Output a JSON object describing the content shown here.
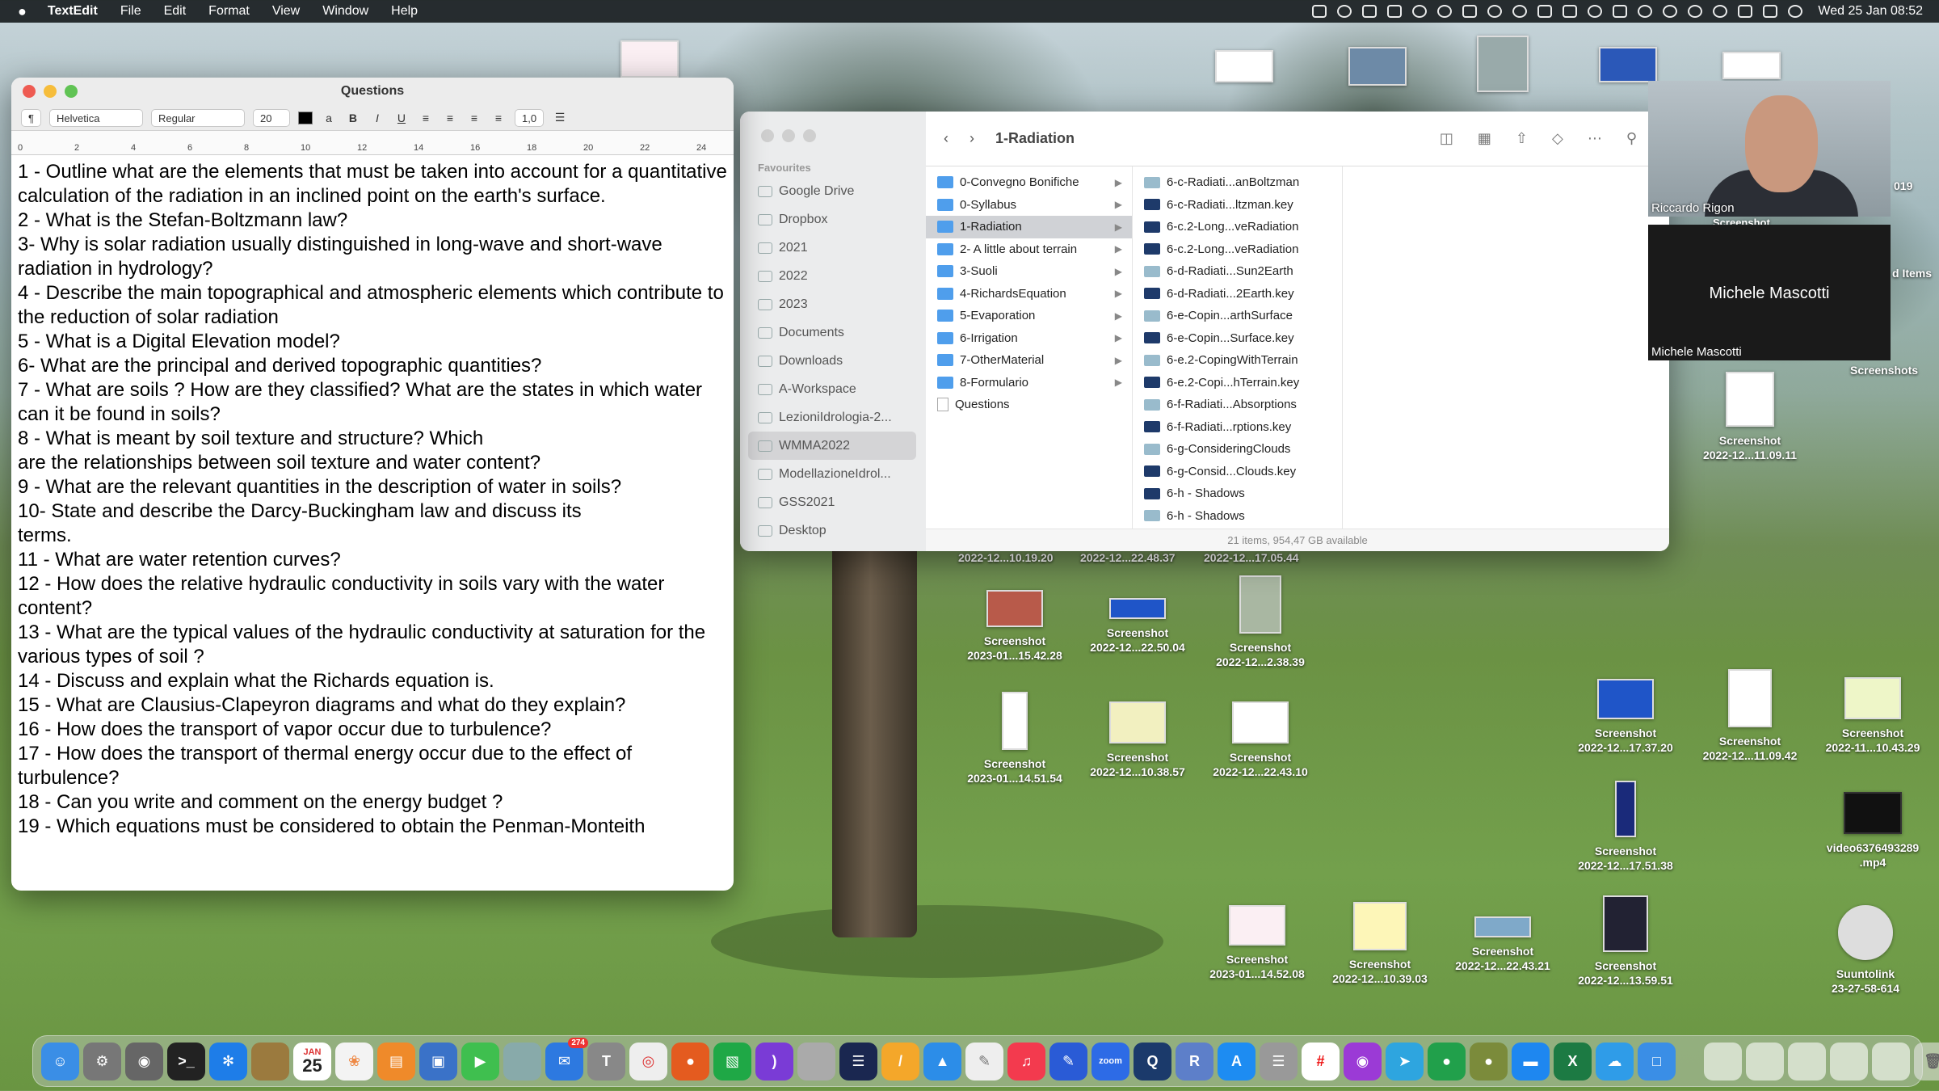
{
  "menubar": {
    "apple": "",
    "app": "TextEdit",
    "menus": [
      "File",
      "Edit",
      "Format",
      "View",
      "Window",
      "Help"
    ],
    "clock": "Wed 25 Jan  08:52"
  },
  "textedit": {
    "title": "Questions",
    "toolbar": {
      "paragraph": "¶",
      "font": "Helvetica",
      "style": "Regular",
      "size": "20",
      "spacing": "1,0"
    },
    "ruler": [
      "0",
      "2",
      "4",
      "6",
      "8",
      "10",
      "12",
      "14",
      "16",
      "18",
      "20",
      "22",
      "24"
    ],
    "lines": [
      "1 - Outline what are the elements that must be taken into account for a quantitative calculation of the radiation in an inclined point on the earth's surface.",
      "2 - What is the Stefan-Boltzmann law?",
      "3- Why is solar radiation usually distinguished in long-wave and short-wave radiation in hydrology?",
      "4 - Describe the main topographical and atmospheric elements which contribute to the reduction of solar radiation",
      "5 - What is a Digital Elevation model?",
      "6- What are the principal and derived topographic quantities?",
      "7 - What are soils ? How are they classified? What are the states in which water",
      "can it be found in soils?",
      "8 - What is meant by soil texture and structure? Which",
      "are the relationships between soil texture and water content?",
      "9 - What are the relevant quantities in the description of water in soils?",
      "10- State and describe the Darcy-Buckingham law and discuss its",
      "terms.",
      "11 - What are water retention curves?",
      "12 - How does the relative hydraulic conductivity in soils vary with the water content?",
      "13 - What are the typical values of the hydraulic conductivity at saturation for the various types of soil ?",
      "14 - Discuss and explain what the Richards equation is.",
      "15 - What are Clausius-Clapeyron diagrams and what do they explain?",
      "16 - How does the transport of vapor occur due to turbulence?",
      "17 - How does the transport of thermal energy occur due to the effect of turbulence?",
      "18 - Can you write and comment on the energy budget ?",
      "19 - Which equations must be considered to obtain the Penman-Monteith"
    ]
  },
  "finder": {
    "title": "1-Radiation",
    "sidebar_header": "Favourites",
    "sidebar": [
      "Google Drive",
      "Dropbox",
      "2021",
      "2022",
      "2023",
      "Documents",
      "Downloads",
      "A-Workspace",
      "LezioniIdrologia-2...",
      "WMMA2022",
      "ModellazioneIdrol...",
      "GSS2021",
      "Desktop"
    ],
    "sidebar_active": "WMMA2022",
    "col1": [
      {
        "name": "0-Convegno Bonifiche",
        "type": "folder"
      },
      {
        "name": "0-Syllabus",
        "type": "folder"
      },
      {
        "name": "1-Radiation",
        "type": "folder",
        "active": true
      },
      {
        "name": "2- A little about terrain",
        "type": "folder"
      },
      {
        "name": "3-Suoli",
        "type": "folder"
      },
      {
        "name": "4-RichardsEquation",
        "type": "folder"
      },
      {
        "name": "5-Evaporation",
        "type": "folder"
      },
      {
        "name": "6-Irrigation",
        "type": "folder"
      },
      {
        "name": "7-OtherMaterial",
        "type": "folder"
      },
      {
        "name": "8-Formulario",
        "type": "folder"
      },
      {
        "name": "Questions",
        "type": "doc"
      }
    ],
    "col2": [
      {
        "name": "6-c-Radiati...anBoltzman",
        "type": "img"
      },
      {
        "name": "6-c-Radiati...ltzman.key",
        "type": "key"
      },
      {
        "name": "6-c.2-Long...veRadiation",
        "type": "key"
      },
      {
        "name": "6-c.2-Long...veRadiation",
        "type": "key"
      },
      {
        "name": "6-d-Radiati...Sun2Earth",
        "type": "img"
      },
      {
        "name": "6-d-Radiati...2Earth.key",
        "type": "key"
      },
      {
        "name": "6-e-Copin...arthSurface",
        "type": "img"
      },
      {
        "name": "6-e-Copin...Surface.key",
        "type": "key"
      },
      {
        "name": "6-e.2-CopingWithTerrain",
        "type": "img"
      },
      {
        "name": "6-e.2-Copi...hTerrain.key",
        "type": "key"
      },
      {
        "name": "6-f-Radiati...Absorptions",
        "type": "img"
      },
      {
        "name": "6-f-Radiati...rptions.key",
        "type": "key"
      },
      {
        "name": "6-g-ConsideringClouds",
        "type": "img"
      },
      {
        "name": "6-g-Consid...Clouds.key",
        "type": "key"
      },
      {
        "name": "6-h - Shadows",
        "type": "key"
      },
      {
        "name": "6-h - Shadows",
        "type": "img"
      }
    ],
    "status": "21 items, 954,47 GB available"
  },
  "video": {
    "p1": "Riccardo Rigon",
    "p2": "Michele Mascotti",
    "p1_caption": "Screenshot"
  },
  "desktop": {
    "screenshot_label": "Screenshot",
    "captions_top": [
      "2022-12...10.19.20",
      "2022-12...22.48.37",
      "2022-12...17.05.44"
    ],
    "icons": [
      {
        "name": "Screenshot",
        "date": "2023-01...15.42.28"
      },
      {
        "name": "Screenshot",
        "date": "2022-12...22.50.04"
      },
      {
        "name": "Screenshot",
        "date": "2022-12...2.38.39"
      },
      {
        "name": "Screenshot",
        "date": "2023-01...14.51.54"
      },
      {
        "name": "Screenshot",
        "date": "2022-12...10.38.57"
      },
      {
        "name": "Screenshot",
        "date": "2022-12...22.43.10"
      },
      {
        "name": "Screenshot",
        "date": "2022-12...11.09.11"
      },
      {
        "name": "Screenshot",
        "date": "2022-12...17.37.20"
      },
      {
        "name": "Screenshot",
        "date": "2022-12...11.09.42"
      },
      {
        "name": "Screenshot",
        "date": "2022-11...10.43.29"
      },
      {
        "name": "Screenshot",
        "date": "2022-12...17.51.38"
      },
      {
        "name": "video6376493289",
        "date": ".mp4"
      },
      {
        "name": "Screenshot",
        "date": "2023-01...14.52.08"
      },
      {
        "name": "Screenshot",
        "date": "2022-12...10.39.03"
      },
      {
        "name": "Screenshot",
        "date": "2022-12...22.43.21"
      },
      {
        "name": "Screenshot",
        "date": "2022-12...13.59.51"
      },
      {
        "name": "Suuntolink",
        "date": "23-27-58-614"
      }
    ],
    "right_edge": [
      "d Items",
      "Screenshots",
      "019"
    ]
  },
  "dock": {
    "calendar_month": "JAN",
    "calendar_day": "25",
    "mail_badge": "274"
  }
}
